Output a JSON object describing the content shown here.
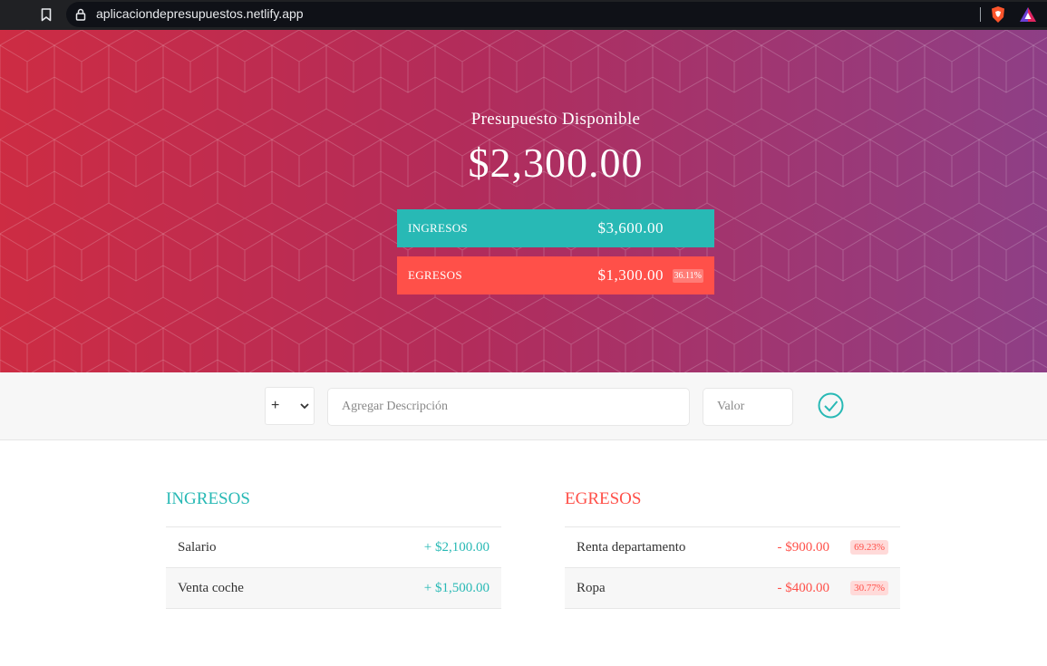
{
  "browser": {
    "url": "aplicaciondepresupuestos.netlify.app",
    "icons": [
      "bookmark-icon",
      "lock-icon",
      "brave-shield-icon",
      "brave-rewards-icon"
    ]
  },
  "colors": {
    "income": "#28b9b5",
    "expense": "#ff5049",
    "hero_gradient_start": "#cd2c43",
    "hero_gradient_end": "#8e3f86"
  },
  "budget": {
    "title": "Presupuesto Disponible",
    "amount": "$2,300.00"
  },
  "summary": {
    "income_label": "INGRESOS",
    "income_value": "$3,600.00",
    "expense_label": "EGRESOS",
    "expense_value": "$1,300.00",
    "expense_percentage": "36.11%"
  },
  "form": {
    "type_selected": "+",
    "description_placeholder": "Agregar Descripción",
    "value_placeholder": "Valor",
    "submit_icon": "check-circle-icon"
  },
  "income": {
    "title": "INGRESOS",
    "items": [
      {
        "description": "Salario",
        "value": "+ $2,100.00"
      },
      {
        "description": "Venta coche",
        "value": "+ $1,500.00"
      }
    ]
  },
  "expenses": {
    "title": "EGRESOS",
    "items": [
      {
        "description": "Renta departamento",
        "value": "- $900.00",
        "percentage": "69.23%"
      },
      {
        "description": "Ropa",
        "value": "- $400.00",
        "percentage": "30.77%"
      }
    ]
  }
}
